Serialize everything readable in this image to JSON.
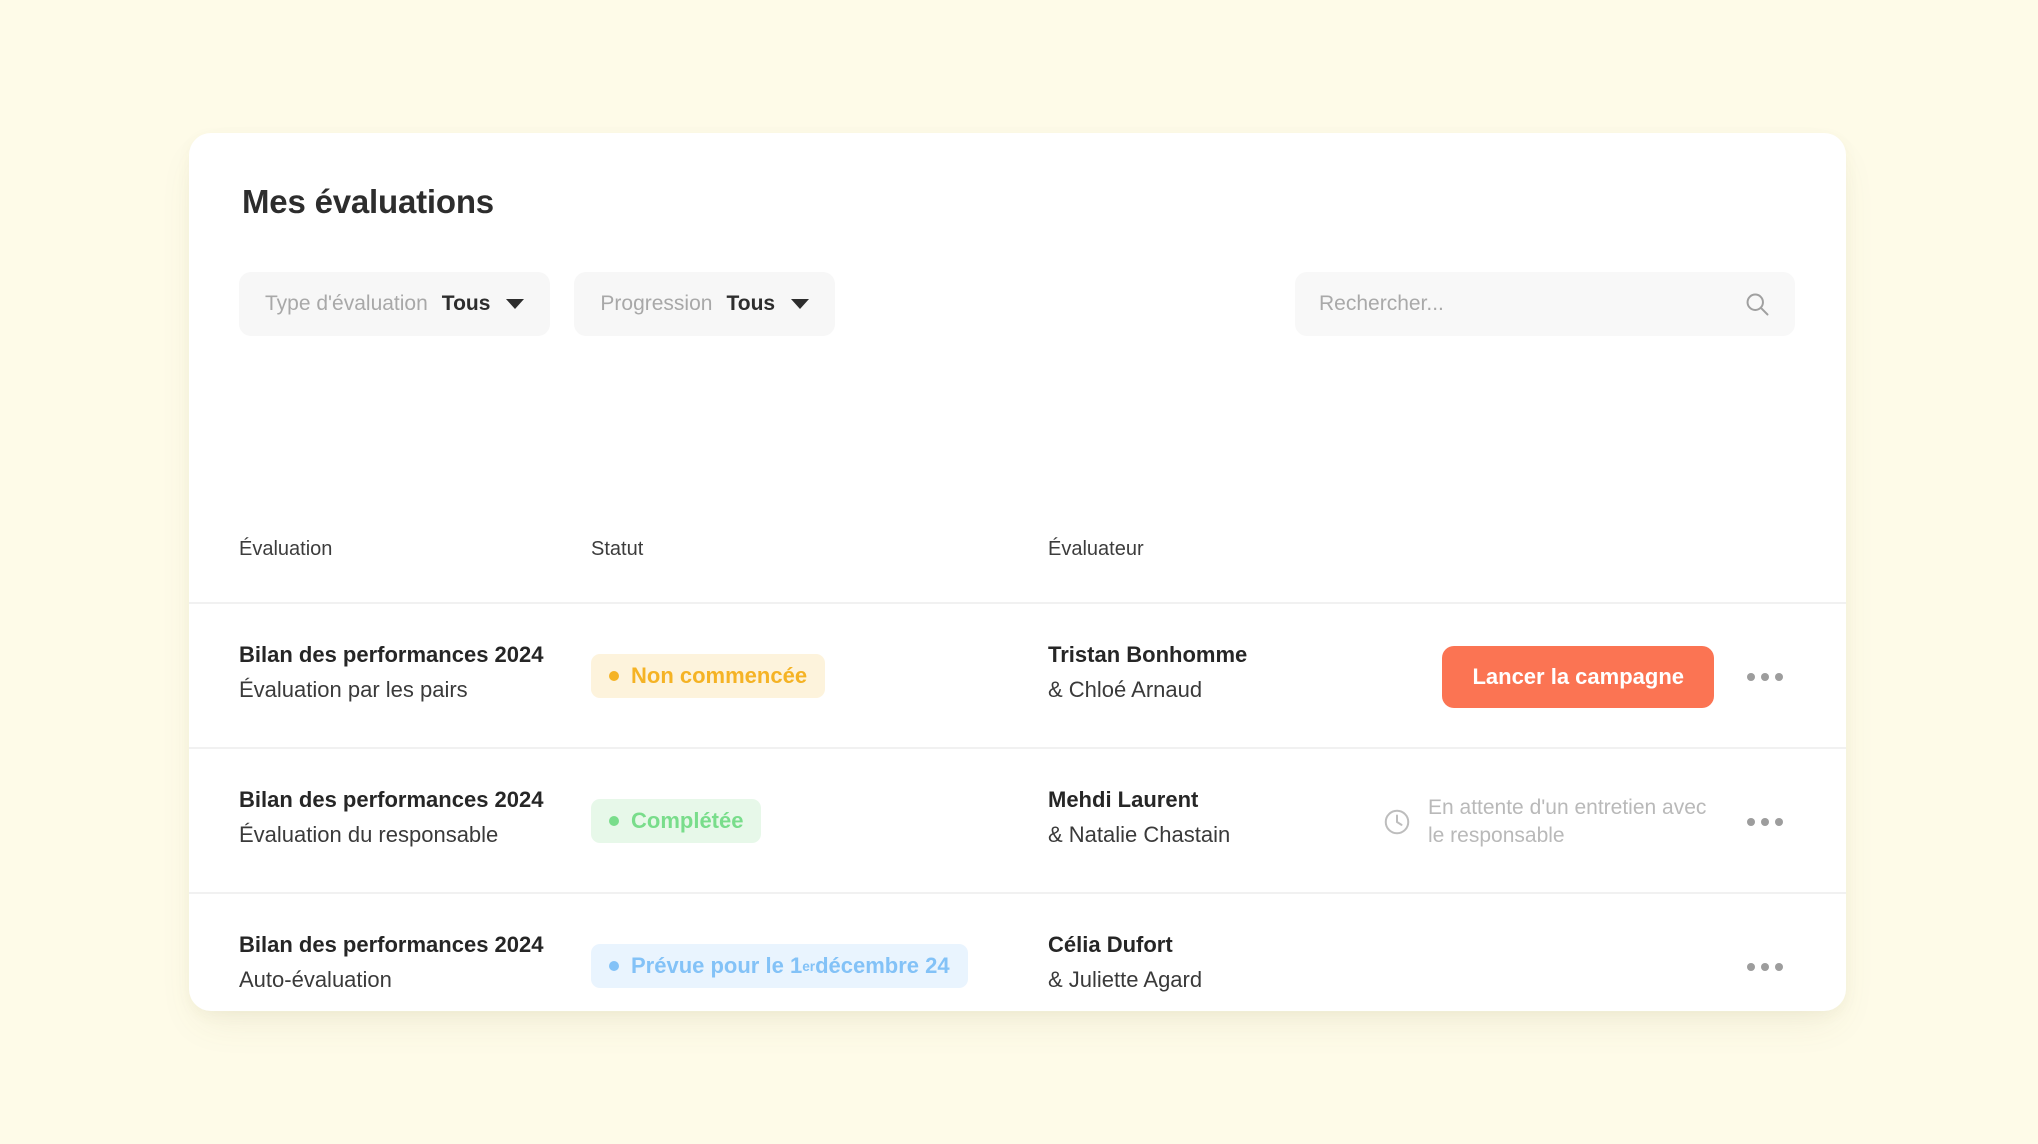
{
  "page": {
    "background_color": "#fefbe8",
    "card_background": "#ffffff"
  },
  "header": {
    "title": "Mes évaluations"
  },
  "filters": {
    "type": {
      "label": "Type d'évaluation",
      "value": "Tous",
      "caret_icon": "chevron-down-icon"
    },
    "progress": {
      "label": "Progression",
      "value": "Tous",
      "caret_icon": "chevron-down-icon"
    }
  },
  "search": {
    "placeholder": "Rechercher...",
    "value": "",
    "icon": "search-icon"
  },
  "table": {
    "columns": [
      "Évaluation",
      "Statut",
      "Évaluateur"
    ],
    "rows": [
      {
        "evaluation_title": "Bilan des performances 2024",
        "evaluation_subtitle": "Évaluation par les pairs",
        "status_label": "Non commencée",
        "status_tone": "amber",
        "status_color": "#f5b325",
        "status_background": "#fdf3dc",
        "evaluator_main": "Tristan Bonhomme",
        "evaluator_sub": "& Chloé Arnaud",
        "action_type": "button",
        "action_label": "Lancer la campagne",
        "action_color": "#fb7453",
        "menu_icon": "ellipsis-icon"
      },
      {
        "evaluation_title": "Bilan des performances 2024",
        "evaluation_subtitle": "Évaluation du responsable",
        "status_label": "Complétée",
        "status_tone": "green",
        "status_color": "#79dd8b",
        "status_background": "#e7f8e9",
        "evaluator_main": "Mehdi Laurent",
        "evaluator_sub": "& Natalie Chastain",
        "action_type": "waiting",
        "action_label": "En attente d'un entretien avec le responsable",
        "action_icon": "clock-icon",
        "menu_icon": "ellipsis-icon"
      },
      {
        "evaluation_title": "Bilan des performances 2024",
        "evaluation_subtitle": "Auto-évaluation",
        "status_label_pre": "Prévue pour le 1",
        "status_label_sup": "er",
        "status_label_post": " décembre 24",
        "status_tone": "blue",
        "status_color": "#83c2f7",
        "status_background": "#e9f4fe",
        "evaluator_main": "Célia Dufort",
        "evaluator_sub": "& Juliette Agard",
        "action_type": "none",
        "menu_icon": "ellipsis-icon"
      }
    ]
  }
}
